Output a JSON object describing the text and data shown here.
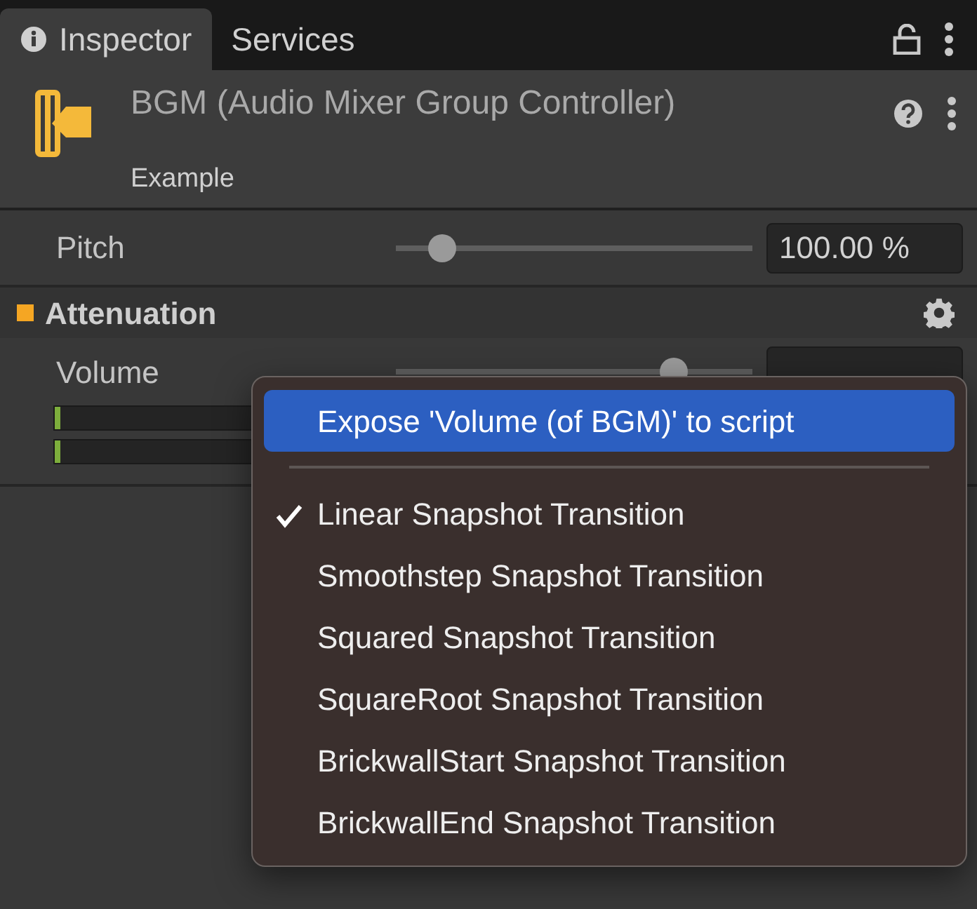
{
  "tabs": [
    {
      "label": "Inspector",
      "selected": true
    },
    {
      "label": "Services",
      "selected": false
    }
  ],
  "header": {
    "title": "BGM (Audio Mixer Group Controller)",
    "subtitle": "Example"
  },
  "pitch": {
    "label": "Pitch",
    "level": 0.13,
    "value": "100.00 %"
  },
  "section": {
    "title": "Attenuation",
    "color": "#f5a623"
  },
  "volume": {
    "label": "Volume",
    "level": 0.78
  },
  "meters": [
    {
      "level": 0.006
    },
    {
      "level": 0.006
    }
  ],
  "menu": {
    "items": [
      {
        "kind": "action",
        "label": "Expose 'Volume (of BGM)' to script",
        "selected": true
      },
      {
        "kind": "separator"
      },
      {
        "kind": "option",
        "label": "Linear Snapshot Transition",
        "checked": true
      },
      {
        "kind": "option",
        "label": "Smoothstep Snapshot Transition",
        "checked": false
      },
      {
        "kind": "option",
        "label": "Squared Snapshot Transition",
        "checked": false
      },
      {
        "kind": "option",
        "label": "SquareRoot Snapshot Transition",
        "checked": false
      },
      {
        "kind": "option",
        "label": "BrickwallStart Snapshot Transition",
        "checked": false
      },
      {
        "kind": "option",
        "label": "BrickwallEnd Snapshot Transition",
        "checked": false
      }
    ]
  }
}
